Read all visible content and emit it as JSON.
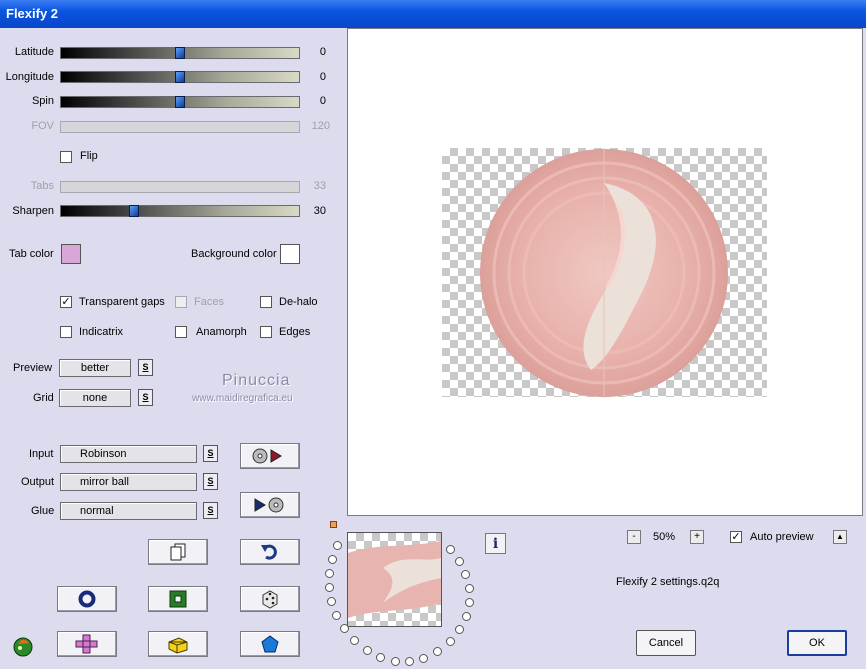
{
  "window": {
    "title": "Flexify 2"
  },
  "sliders": [
    {
      "id": "latitude",
      "label": "Latitude",
      "value": "0",
      "level": 0.5,
      "enabled": true
    },
    {
      "id": "longitude",
      "label": "Longitude",
      "value": "0",
      "level": 0.5,
      "enabled": true
    },
    {
      "id": "spin",
      "label": "Spin",
      "value": "0",
      "level": 0.5,
      "enabled": true
    },
    {
      "id": "fov",
      "label": "FOV",
      "value": "120",
      "level": 1.0,
      "enabled": false
    },
    {
      "id": "tabs",
      "label": "Tabs",
      "value": "33",
      "level": 0.33,
      "enabled": false
    },
    {
      "id": "sharpen",
      "label": "Sharpen",
      "value": "30",
      "level": 0.3,
      "enabled": true
    }
  ],
  "flip": {
    "label": "Flip",
    "checked": false
  },
  "tab_color": {
    "label": "Tab color",
    "color": "#d9a6d8"
  },
  "background_color": {
    "label": "Background color",
    "color": "#ffffff"
  },
  "options": {
    "transparent_gaps": {
      "label": "Transparent gaps",
      "checked": true
    },
    "faces": {
      "label": "Faces",
      "checked": false,
      "enabled": false
    },
    "de_halo": {
      "label": "De-halo",
      "checked": false
    },
    "indicatrix": {
      "label": "Indicatrix",
      "checked": false
    },
    "anamorph": {
      "label": "Anamorph",
      "checked": false
    },
    "edges": {
      "label": "Edges",
      "checked": false
    }
  },
  "preview_mode": {
    "label": "Preview",
    "value": "better",
    "s": "S"
  },
  "grid": {
    "label": "Grid",
    "value": "none",
    "s": "S"
  },
  "watermark": {
    "line1": "Pinuccia",
    "line2": "www.maidiregrafica.eu"
  },
  "projection": {
    "input": {
      "label": "Input",
      "value": "Robinson",
      "s": "S"
    },
    "output": {
      "label": "Output",
      "value": "mirror ball",
      "s": "S"
    },
    "glue": {
      "label": "Glue",
      "value": "normal",
      "s": "S"
    }
  },
  "zoom": {
    "minus": "-",
    "value": "50%",
    "plus": "+"
  },
  "auto_preview": {
    "label": "Auto preview",
    "checked": true,
    "arrow": "▲"
  },
  "settings_file": "Flexify 2 settings.q2q",
  "info_button": "i",
  "buttons": {
    "cancel": "Cancel",
    "ok": "OK"
  },
  "colors": {
    "sphere_pink": "#e8b4b0",
    "sphere_light": "#ebe1d9",
    "accent_blue": "#1a3e9c"
  }
}
